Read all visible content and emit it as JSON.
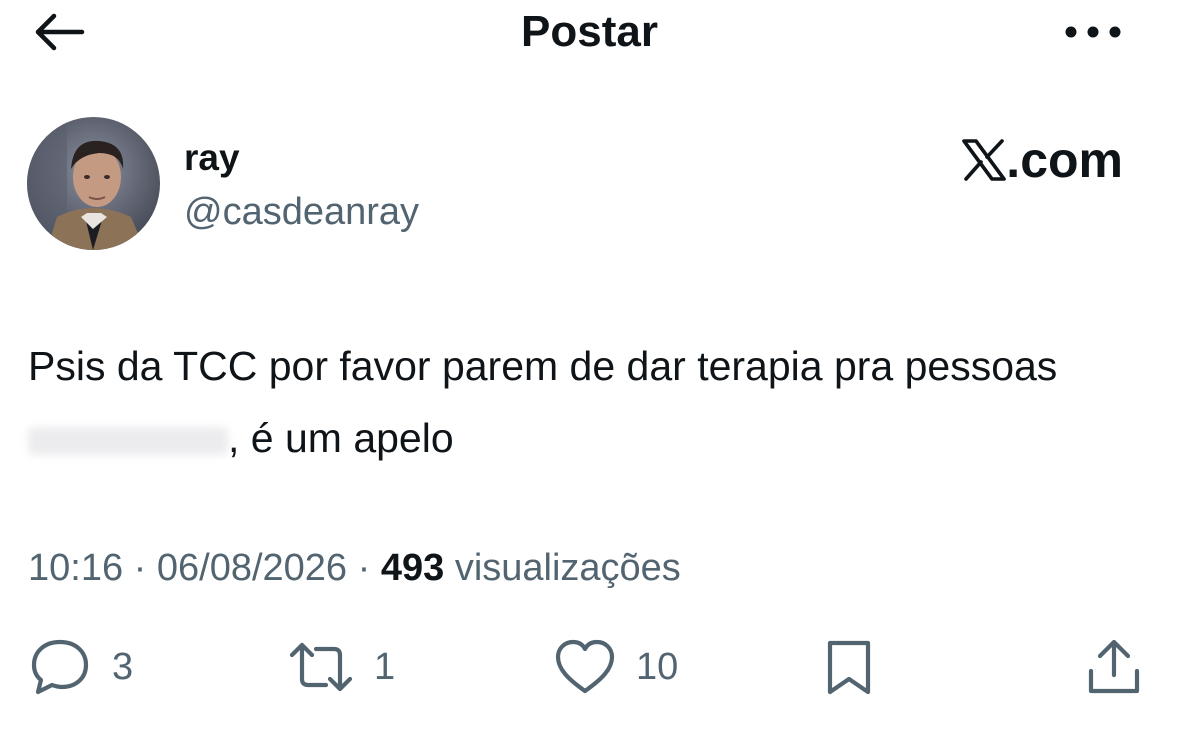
{
  "header": {
    "title": "Postar"
  },
  "tweet": {
    "name": "ray",
    "handle": "@casdeanray",
    "source": ".com",
    "text_part1": "Psis da TCC por favor parem de dar terapia pra pessoas",
    "text_part2": ", é um apelo",
    "time": "10:16",
    "date": "06/08/2026",
    "separator": "·",
    "views_count": "493",
    "views_label": "visualizações"
  },
  "actions": {
    "replies": "3",
    "reposts": "1",
    "likes": "10"
  },
  "colors": {
    "text": "#0f1419",
    "secondary": "#536471",
    "background": "#ffffff"
  },
  "icons": [
    "back-arrow-icon",
    "more-icon",
    "x-logo-icon",
    "reply-icon",
    "repost-icon",
    "like-icon",
    "bookmark-icon",
    "share-icon"
  ]
}
